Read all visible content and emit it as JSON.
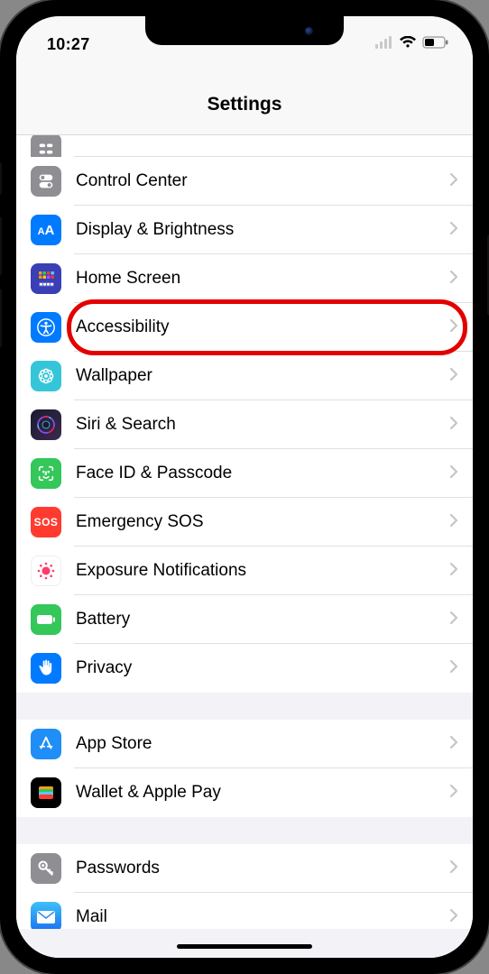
{
  "status": {
    "time": "10:27"
  },
  "header": {
    "title": "Settings"
  },
  "groups": [
    {
      "rows": [
        {
          "label": "",
          "icon": "general",
          "partial": true
        },
        {
          "label": "Control Center",
          "icon": "control-center"
        },
        {
          "label": "Display & Brightness",
          "icon": "display"
        },
        {
          "label": "Home Screen",
          "icon": "home-screen"
        },
        {
          "label": "Accessibility",
          "icon": "accessibility",
          "highlighted": true
        },
        {
          "label": "Wallpaper",
          "icon": "wallpaper"
        },
        {
          "label": "Siri & Search",
          "icon": "siri"
        },
        {
          "label": "Face ID & Passcode",
          "icon": "faceid"
        },
        {
          "label": "Emergency SOS",
          "icon": "sos"
        },
        {
          "label": "Exposure Notifications",
          "icon": "exposure"
        },
        {
          "label": "Battery",
          "icon": "battery"
        },
        {
          "label": "Privacy",
          "icon": "privacy"
        }
      ]
    },
    {
      "rows": [
        {
          "label": "App Store",
          "icon": "appstore"
        },
        {
          "label": "Wallet & Apple Pay",
          "icon": "wallet"
        }
      ]
    },
    {
      "rows": [
        {
          "label": "Passwords",
          "icon": "passwords"
        },
        {
          "label": "Mail",
          "icon": "mail"
        }
      ]
    }
  ]
}
